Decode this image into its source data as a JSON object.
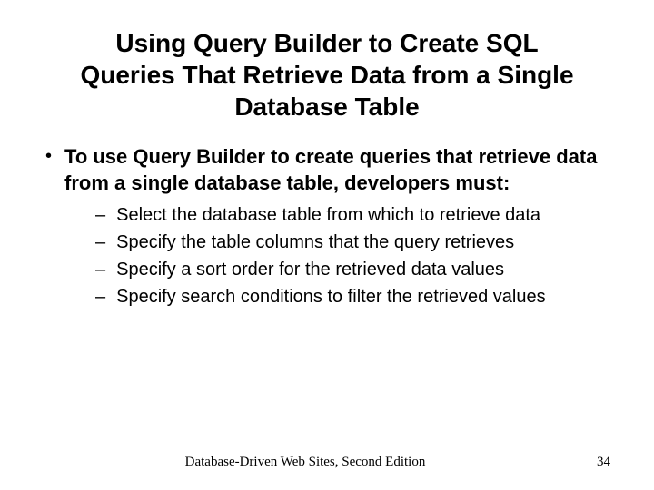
{
  "title": "Using Query Builder to Create SQL Queries That Retrieve Data from a Single Database Table",
  "bullet": {
    "text": "To use Query Builder to create queries that retrieve data from a single database table, developers must:"
  },
  "subitems": {
    "0": "Select the database table from which to retrieve data",
    "1": "Specify the table columns that the query retrieves",
    "2": "Specify a sort order for the retrieved data values",
    "3": "Specify search conditions to filter the retrieved values"
  },
  "footer": {
    "text": "Database-Driven Web Sites, Second Edition",
    "page": "34"
  }
}
